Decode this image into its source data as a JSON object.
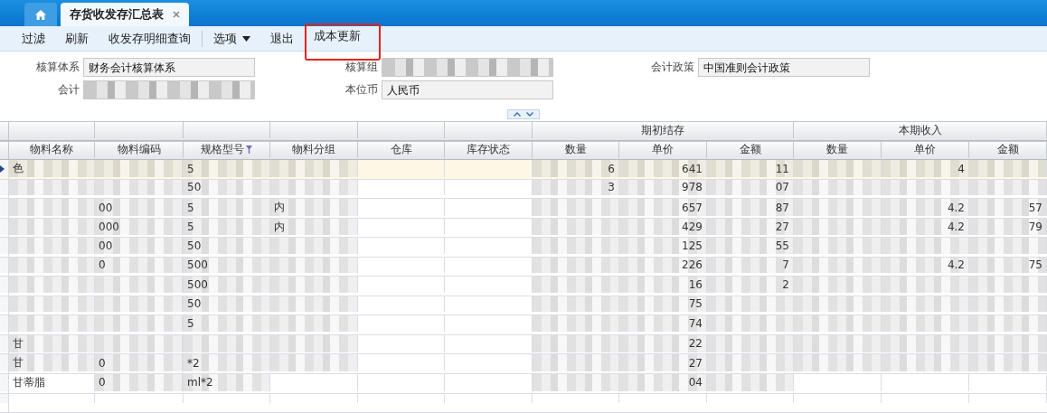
{
  "tabs": [
    {
      "kind": "home",
      "selected": false
    },
    {
      "kind": "page",
      "label": "存货收发存汇总表",
      "selected": true
    }
  ],
  "toolbar": [
    {
      "label": "过滤",
      "highlighted": false,
      "dropdown": false
    },
    {
      "label": "刷新",
      "highlighted": false,
      "dropdown": false
    },
    {
      "label": "收发存明细查询",
      "highlighted": false,
      "dropdown": false
    },
    {
      "label": "选项",
      "highlighted": false,
      "dropdown": true
    },
    {
      "label": "退出",
      "highlighted": false,
      "dropdown": false
    },
    {
      "label": "成本更新",
      "highlighted": true,
      "dropdown": false
    }
  ],
  "form": [
    {
      "label": "核算体系",
      "value": "财务会计核算体系",
      "blurred": false
    },
    {
      "label": "核算组",
      "blurred": true
    },
    {
      "label": "会计政策",
      "value": "中国准则会计政策",
      "blurred": false
    },
    {
      "label": "会计",
      "blurred": true
    },
    {
      "label": "本位币",
      "value": "人民币",
      "blurred": false
    }
  ],
  "table": {
    "groups": [
      {
        "label": "期初结存"
      },
      {
        "label": "本期收入"
      }
    ],
    "columns": [
      {
        "label": "物料名称",
        "filter": false
      },
      {
        "label": "物料编码",
        "filter": false
      },
      {
        "label": "规格型号",
        "filter": true
      },
      {
        "label": "物料分组",
        "filter": false
      },
      {
        "label": "仓库",
        "filter": false
      },
      {
        "label": "库存状态",
        "filter": false
      },
      {
        "label": "数量",
        "filter": false
      },
      {
        "label": "单价",
        "filter": false
      },
      {
        "label": "金额",
        "filter": false
      },
      {
        "label": "数量",
        "filter": false
      },
      {
        "label": "单价",
        "filter": false
      },
      {
        "label": "金额",
        "filter": false
      }
    ],
    "rows": [
      {
        "selected": true,
        "cells": [
          {
            "text": "色",
            "blurred": true
          },
          {
            "blurred": true
          },
          {
            "text": "5",
            "blurred": true
          },
          {
            "blurred": true
          },
          {},
          {},
          {
            "text": "6",
            "blurred": true
          },
          {
            "text": "641",
            "blurred": true
          },
          {
            "text": "11",
            "blurred": true
          },
          {
            "blurred": true
          },
          {
            "text": "4",
            "blurred": true
          },
          {
            "blurred": true
          }
        ]
      },
      {
        "selected": false,
        "cells": [
          {
            "blurred": true
          },
          {
            "blurred": true
          },
          {
            "text": "50",
            "blurred": true
          },
          {
            "blurred": true
          },
          {},
          {},
          {
            "text": "3",
            "blurred": true
          },
          {
            "text": "978",
            "blurred": true
          },
          {
            "text": "07",
            "blurred": true
          },
          {
            "blurred": true
          },
          {
            "blurred": true
          },
          {
            "blurred": true
          }
        ]
      },
      {
        "selected": false,
        "cells": [
          {
            "blurred": true
          },
          {
            "text": "00",
            "blurred": true
          },
          {
            "text": "5",
            "blurred": true
          },
          {
            "text": "内",
            "blurred": true
          },
          {},
          {},
          {
            "blurred": true
          },
          {
            "text": "657",
            "blurred": true
          },
          {
            "text": "87",
            "blurred": true
          },
          {
            "blurred": true
          },
          {
            "text": "4.2",
            "blurred": true
          },
          {
            "text": "57",
            "blurred": true
          }
        ]
      },
      {
        "selected": false,
        "cells": [
          {
            "blurred": true
          },
          {
            "text": "000",
            "blurred": true
          },
          {
            "text": "5",
            "blurred": true
          },
          {
            "text": "内",
            "blurred": true
          },
          {},
          {},
          {
            "blurred": true
          },
          {
            "text": "429",
            "blurred": true
          },
          {
            "text": "27",
            "blurred": true
          },
          {
            "blurred": true
          },
          {
            "text": "4.2",
            "blurred": true
          },
          {
            "text": "79",
            "blurred": true
          }
        ]
      },
      {
        "selected": false,
        "cells": [
          {
            "blurred": true
          },
          {
            "text": "00",
            "blurred": true
          },
          {
            "text": "50",
            "blurred": true
          },
          {
            "blurred": true
          },
          {},
          {},
          {
            "blurred": true
          },
          {
            "text": "125",
            "blurred": true
          },
          {
            "text": "55",
            "blurred": true
          },
          {
            "blurred": true
          },
          {
            "blurred": true
          },
          {
            "blurred": true
          }
        ]
      },
      {
        "selected": false,
        "cells": [
          {
            "blurred": true
          },
          {
            "text": "0",
            "blurred": true
          },
          {
            "text": "500",
            "blurred": true
          },
          {
            "blurred": true
          },
          {},
          {},
          {
            "blurred": true
          },
          {
            "text": "226",
            "blurred": true
          },
          {
            "text": "7",
            "blurred": true
          },
          {
            "blurred": true
          },
          {
            "text": "4.2",
            "blurred": true
          },
          {
            "text": "75",
            "blurred": true
          }
        ]
      },
      {
        "selected": false,
        "cells": [
          {
            "blurred": true
          },
          {
            "blurred": true
          },
          {
            "text": "500",
            "blurred": true
          },
          {
            "blurred": true
          },
          {},
          {},
          {
            "blurred": true
          },
          {
            "text": "16",
            "blurred": true
          },
          {
            "text": "2",
            "blurred": true
          },
          {
            "blurred": true
          },
          {
            "blurred": true
          },
          {
            "blurred": true
          }
        ]
      },
      {
        "selected": false,
        "cells": [
          {
            "blurred": true
          },
          {
            "blurred": true
          },
          {
            "text": "50",
            "blurred": true
          },
          {
            "blurred": true
          },
          {},
          {},
          {
            "blurred": true
          },
          {
            "text": "75",
            "blurred": true
          },
          {
            "blurred": true
          },
          {
            "blurred": true
          },
          {
            "blurred": true
          },
          {
            "blurred": true
          }
        ]
      },
      {
        "selected": false,
        "cells": [
          {
            "blurred": true
          },
          {
            "blurred": true
          },
          {
            "text": "5",
            "blurred": true
          },
          {
            "blurred": true
          },
          {},
          {},
          {
            "blurred": true
          },
          {
            "text": "74",
            "blurred": true
          },
          {
            "blurred": true
          },
          {
            "blurred": true
          },
          {
            "blurred": true
          },
          {
            "blurred": true
          }
        ]
      },
      {
        "selected": false,
        "cells": [
          {
            "text": "甘",
            "blurred": true
          },
          {
            "blurred": true
          },
          {
            "blurred": true
          },
          {
            "blurred": true
          },
          {},
          {},
          {
            "blurred": true
          },
          {
            "text": "22",
            "blurred": true
          },
          {
            "blurred": true
          },
          {
            "blurred": true
          },
          {
            "blurred": true
          },
          {
            "blurred": true
          }
        ]
      },
      {
        "selected": false,
        "cells": [
          {
            "text": "甘",
            "blurred": true
          },
          {
            "text": "0",
            "blurred": true
          },
          {
            "text": "*2",
            "blurred": true
          },
          {
            "blurred": true
          },
          {},
          {},
          {
            "blurred": true
          },
          {
            "text": "27",
            "blurred": true
          },
          {
            "blurred": true
          },
          {
            "blurred": true
          },
          {
            "blurred": true
          },
          {
            "blurred": true
          }
        ]
      },
      {
        "selected": false,
        "cells": [
          {
            "text": "甘蒂脂",
            "blurred": false
          },
          {
            "text": "0",
            "blurred": true
          },
          {
            "text": "ml*2",
            "blurred": true
          },
          {},
          {},
          {},
          {
            "blurred": true
          },
          {
            "text": "04",
            "blurred": true
          },
          {
            "blurred": true
          },
          {},
          {},
          {}
        ]
      },
      {
        "selected": false,
        "cells": [
          {},
          {},
          {},
          {},
          {},
          {},
          {},
          {},
          {},
          {},
          {},
          {}
        ]
      }
    ]
  }
}
